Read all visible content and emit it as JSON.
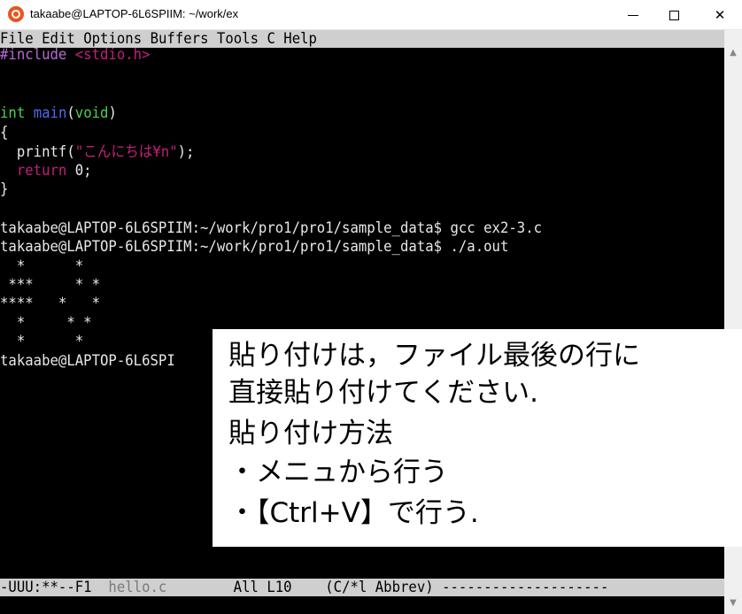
{
  "window": {
    "title": "takaabe@LAPTOP-6L6SPIIM: ~/work/ex",
    "minimize_glyph": "—",
    "maximize_glyph": "☐",
    "close_glyph": "✕",
    "icon": "ubuntu-icon"
  },
  "menubar": {
    "items": [
      "File",
      "Edit",
      "Options",
      "Buffers",
      "Tools",
      "C",
      "Help"
    ]
  },
  "code": {
    "include_kw": "#include",
    "include_hdr": "<stdio.h>",
    "main_type": "int",
    "main_name": "main",
    "main_open": "(",
    "main_void": "void",
    "main_close": ")",
    "brace_open": "{",
    "printf_fn": "  printf(",
    "printf_str": "\"こんにちは¥n\"",
    "printf_end": ");",
    "return_kw": "  return",
    "return_val": " 0;",
    "brace_close": "}"
  },
  "shell": {
    "cmd1": "takaabe@LAPTOP-6L6SPIIM:~/work/pro1/pro1/sample_data$ gcc ex2-3.c",
    "cmd2": "takaabe@LAPTOP-6L6SPIIM:~/work/pro1/pro1/sample_data$ ./a.out",
    "out1": "  *      *",
    "out2": " ***     * *",
    "out3": "****   *   *",
    "out4": "  *     * *",
    "out5": "  *      *",
    "prompt_partial": "takaabe@LAPTOP-6L6SPI"
  },
  "modeline": {
    "left": "-UUU:**--F1  ",
    "buffer": "hello.c",
    "right": "        All L10    (C/*l Abbrev) --------------------"
  },
  "note": {
    "line1": "貼り付けは，ファイル最後の行に",
    "line2": "直接貼り付けてください.",
    "line3": "貼り付け方法",
    "line4": "・メニュから行う",
    "line5": "・【Ctrl+V】で行う."
  }
}
